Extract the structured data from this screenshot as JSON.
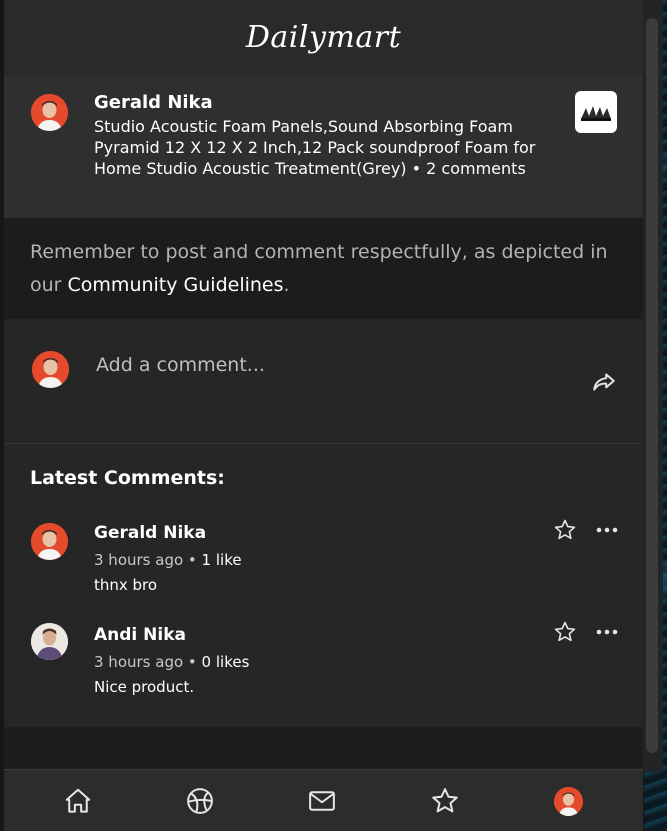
{
  "header": {
    "logo": "Dailymart"
  },
  "product": {
    "user_name": "Gerald Nika",
    "title": "Studio Acoustic Foam Panels,Sound Absorbing Foam Pyramid 12 X 12 X 2 Inch,12 Pack soundproof Foam for Home Studio Acoustic Treatment(Grey) • 2 comments"
  },
  "notice": {
    "text": "Remember to post and comment respectfully, as depicted in our ",
    "link": "Community Guidelines",
    "end": "."
  },
  "composer": {
    "placeholder": "Add a comment..."
  },
  "comments_section": {
    "title": "Latest Comments:",
    "comments": [
      {
        "name": "Gerald Nika",
        "time": "3 hours ago",
        "likes": "1 like",
        "text": "thnx bro"
      },
      {
        "name": "Andi Nika",
        "time": "3 hours ago",
        "likes": "0 likes",
        "text": "Nice product."
      }
    ]
  },
  "icons": {
    "share": "share-icon",
    "star": "star-icon",
    "more": "more-icon",
    "nav": [
      "home-icon",
      "explore-icon",
      "mail-icon",
      "star-icon",
      "avatar"
    ]
  },
  "colors": {
    "avatar_red": "#e54a2c",
    "background": "#262626"
  }
}
